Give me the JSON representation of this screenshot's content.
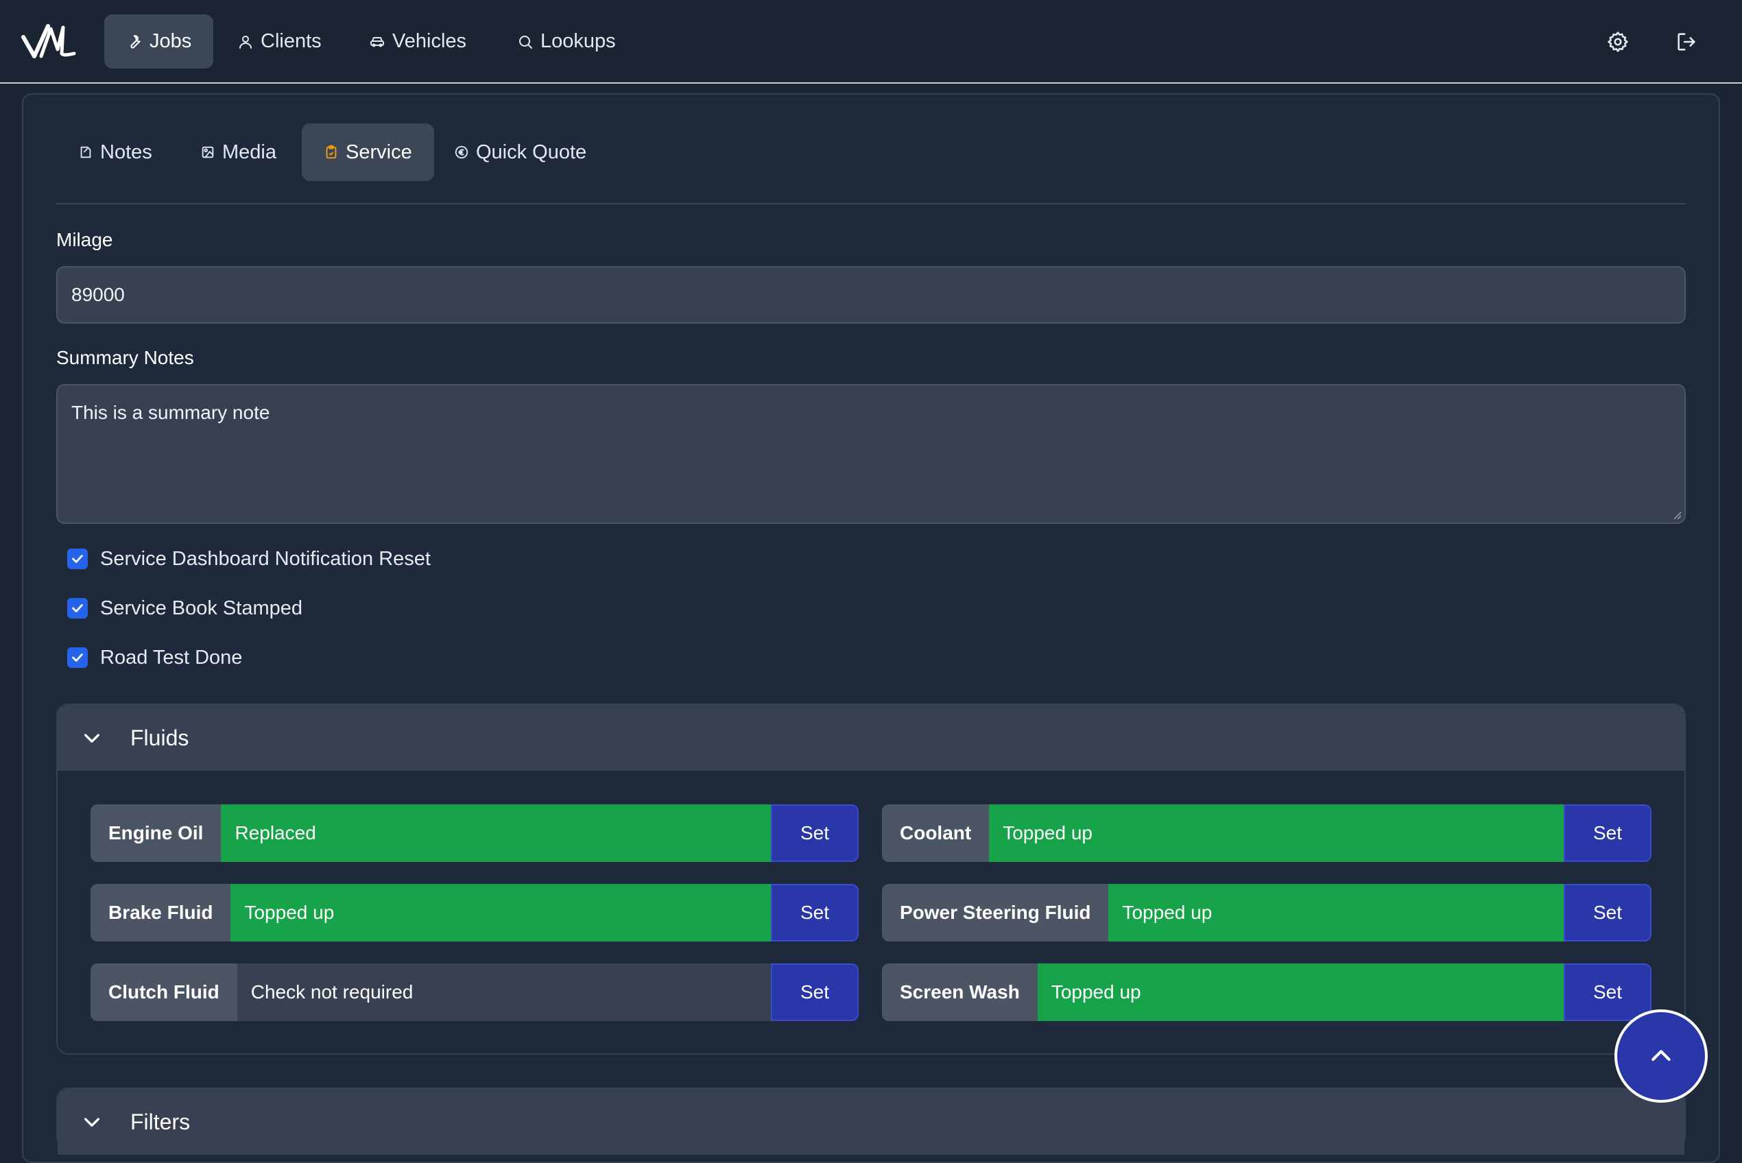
{
  "nav": {
    "logo": "VM logo",
    "items": [
      {
        "label": "Jobs",
        "icon": "wrench-icon",
        "active": true
      },
      {
        "label": "Clients",
        "icon": "user-icon",
        "active": false
      },
      {
        "label": "Vehicles",
        "icon": "car-icon",
        "active": false
      },
      {
        "label": "Lookups",
        "icon": "search-icon",
        "active": false
      }
    ],
    "settings_icon": "gear-icon",
    "logout_icon": "logout-icon"
  },
  "tabs": [
    {
      "label": "Notes",
      "icon": "notes-icon",
      "active": false
    },
    {
      "label": "Media",
      "icon": "image-icon",
      "active": false
    },
    {
      "label": "Service",
      "icon": "clipboard-icon",
      "active": true
    },
    {
      "label": "Quick Quote",
      "icon": "euro-icon",
      "active": false
    }
  ],
  "service": {
    "milage_label": "Milage",
    "milage_value": "89000",
    "summary_label": "Summary Notes",
    "summary_value": "This is a summary note",
    "checkboxes": [
      {
        "label": "Service Dashboard Notification Reset",
        "checked": true
      },
      {
        "label": "Service Book Stamped",
        "checked": true
      },
      {
        "label": "Road Test Done",
        "checked": true
      }
    ]
  },
  "fluids": {
    "title": "Fluids",
    "set_label": "Set",
    "items": [
      {
        "label": "Engine Oil",
        "status": "Replaced",
        "state": "ok"
      },
      {
        "label": "Coolant",
        "status": "Topped up",
        "state": "ok"
      },
      {
        "label": "Brake Fluid",
        "status": "Topped up",
        "state": "ok"
      },
      {
        "label": "Power Steering Fluid",
        "status": "Topped up",
        "state": "ok"
      },
      {
        "label": "Clutch Fluid",
        "status": "Check not required",
        "state": "neutral"
      },
      {
        "label": "Screen Wash",
        "status": "Topped up",
        "state": "ok"
      }
    ]
  },
  "filters": {
    "title": "Filters"
  },
  "colors": {
    "background": "#1b2433",
    "panel": "#1e293b",
    "active_tab": "#3b4657",
    "status_ok": "#16a34a",
    "set_button": "#2937a8",
    "checkbox": "#2563eb",
    "service_icon": "#f59e0b"
  }
}
